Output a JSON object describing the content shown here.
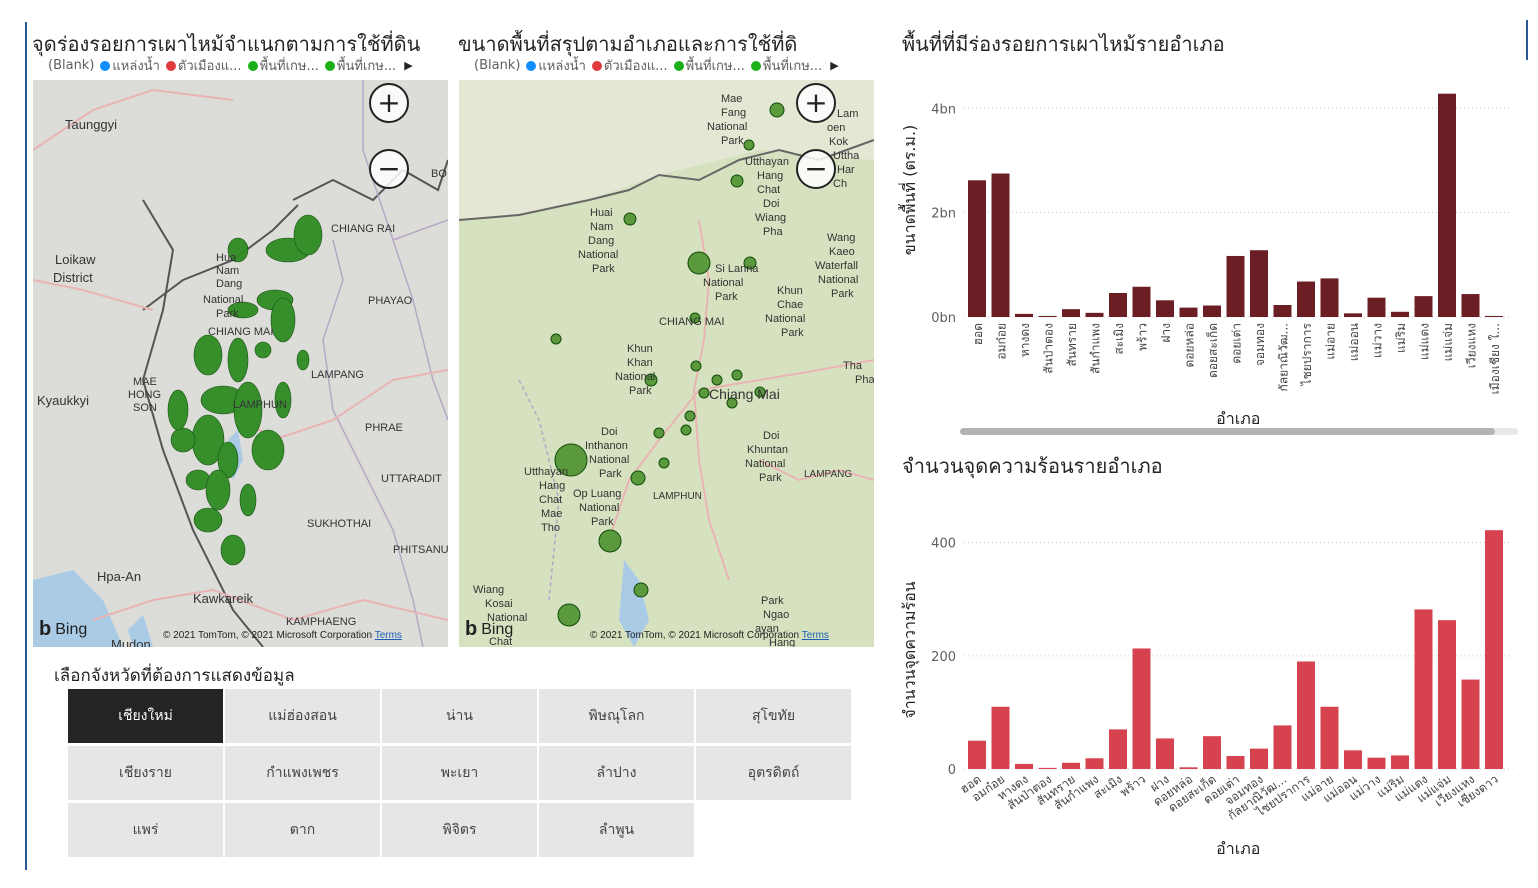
{
  "visuals": {
    "map1_title": "จุดร่องรอยการเผาไหม้จำแนกตามการใช้ที่ดิน",
    "map2_title": "ขนาดพื้นที่สรุปตามอำเภอและการใช้ที่ดิ",
    "legend": {
      "blank": "(Blank)",
      "items": [
        {
          "label": "แหล่งน้ำ",
          "color": "#118dff"
        },
        {
          "label": "ตัวเมืองแ...",
          "color": "#e03a3e"
        },
        {
          "label": "พื้นที่เกษ...",
          "color": "#1ab01a"
        },
        {
          "label": "พื้นที่เกษ...",
          "color": "#1ab01a"
        }
      ]
    },
    "map1_places": [
      "Taunggyi",
      "Loikaw",
      "District",
      "CHIANG RAI",
      "PHAYAO",
      "MAE",
      "HONG",
      "SON",
      "Kyaukkyi",
      "LAMPANG",
      "LAMPHUN",
      "PHRAE",
      "UTTARADIT",
      "SUKHOTHAI",
      "PHITSANU",
      "Hpa-An",
      "Kawkareik",
      "KAMPHAENG",
      "Mudon",
      "BO",
      "Hua",
      "Nam",
      "Dang",
      "National",
      "Park",
      "CHIANG MAI"
    ],
    "map2_places": [
      "Mae",
      "Fang",
      "National",
      "Park",
      "Utthayan",
      "Hang",
      "Chat",
      "Doi",
      "Wiang",
      "Pha",
      "Huai",
      "Nam",
      "Dang",
      "National",
      "Park",
      "Si Lanna",
      "National",
      "Park",
      "Khun",
      "Chae",
      "National",
      "Park",
      "Wang",
      "Kaeo",
      "Waterfall",
      "National",
      "Park",
      "CHIANG MAI",
      "Khun",
      "Khan",
      "National",
      "Park",
      "Chiang Mai",
      "Doi",
      "Inthanon",
      "National",
      "Park",
      "Doi",
      "Khuntan",
      "National",
      "Park",
      "LAMPANG",
      "LAMPHUN",
      "Op Luang",
      "National",
      "Park",
      "Utthayan",
      "Hang",
      "Chat",
      "Mae",
      "Tho",
      "Wiang",
      "Kosai",
      "National",
      "Park",
      "Ngao",
      "ayan",
      "Hang",
      "Chat",
      "Lam",
      "oen",
      "Kok",
      "Uttha",
      "Har",
      "Ch",
      "Tha",
      "Phat"
    ],
    "bing": "Bing",
    "copyright": "© 2021 TomTom, © 2021 Microsoft Corporation",
    "terms": "Terms",
    "zoom_in": "+",
    "zoom_out": "−"
  },
  "slicer": {
    "title": "เลือกจังหวัดที่ต้องการแสดงข้อมูล",
    "options": [
      "เชียงใหม่",
      "แม่ฮ่องสอน",
      "น่าน",
      "พิษณุโลก",
      "สุโขทัย",
      "เชียงราย",
      "กำแพงเพชร",
      "พะเยา",
      "ลำปาง",
      "อุตรดิตถ์",
      "แพร่",
      "ตาก",
      "พิจิตร",
      "ลำพูน"
    ],
    "selected": "เชียงใหม่"
  },
  "chart_data": [
    {
      "type": "bar",
      "title": "พื้นที่ที่มีร่องรอยการเผาไหม้รายอำเภอ",
      "xlabel": "อำเภอ",
      "ylabel": "ขนาดพื้นที่ (ตร.ม.)",
      "color": "#6b1f24",
      "yticks": [
        "0bn",
        "2bn",
        "4bn"
      ],
      "ylim": [
        0,
        4.6
      ],
      "categories": [
        "ฮอด",
        "อมก๋อย",
        "หางดง",
        "สันป่าตอง",
        "สันทราย",
        "สันกำแพง",
        "สะเมิง",
        "พร้าว",
        "ฝาง",
        "ดอยหล่อ",
        "ดอยสะเก็ด",
        "ดอยเต่า",
        "จอมทอง",
        "กัลยาณิวัฒ...",
        "ไชยปราการ",
        "แม่อาย",
        "แม่ออน",
        "แม่วาง",
        "แม่ริม",
        "แม่แตง",
        "แม่แจ่ม",
        "เวียงแหง",
        "เมืองเชียง ใ..."
      ],
      "values": [
        2.62,
        2.75,
        0.06,
        0.02,
        0.15,
        0.08,
        0.46,
        0.58,
        0.32,
        0.18,
        0.22,
        1.17,
        1.28,
        0.23,
        0.68,
        0.74,
        0.07,
        0.37,
        0.1,
        0.4,
        4.28,
        0.44,
        0.02
      ],
      "grid": true
    },
    {
      "type": "bar",
      "title": "จำนวนจุดความร้อนรายอำเภอ",
      "xlabel": "อำเภอ",
      "ylabel": "จำนวนจุดความร้อน",
      "color": "#d6434f",
      "yticks": [
        "0",
        "200",
        "400"
      ],
      "ylim": [
        0,
        440
      ],
      "categories": [
        "ฮอด",
        "อมก๋อย",
        "หางดง",
        "สันป่าตอง",
        "สันทราย",
        "สันกำแพง",
        "สะเมิง",
        "พร้าว",
        "ฝาง",
        "ดอยหล่อ",
        "ดอยสะเก็ด",
        "ดอยเต่า",
        "จอมทอง",
        "กัลยาณิวัฒ...",
        "ไชยปราการ",
        "แม่อาย",
        "แม่ออน",
        "แม่วาง",
        "แม่ริม",
        "แม่แตง",
        "แม่แจ่ม",
        "เวียงแหง",
        "เชียงดาว"
      ],
      "values": [
        50,
        110,
        9,
        2,
        11,
        19,
        70,
        213,
        54,
        3,
        58,
        23,
        36,
        77,
        190,
        110,
        33,
        20,
        24,
        282,
        263,
        158,
        422
      ],
      "grid": true
    }
  ]
}
